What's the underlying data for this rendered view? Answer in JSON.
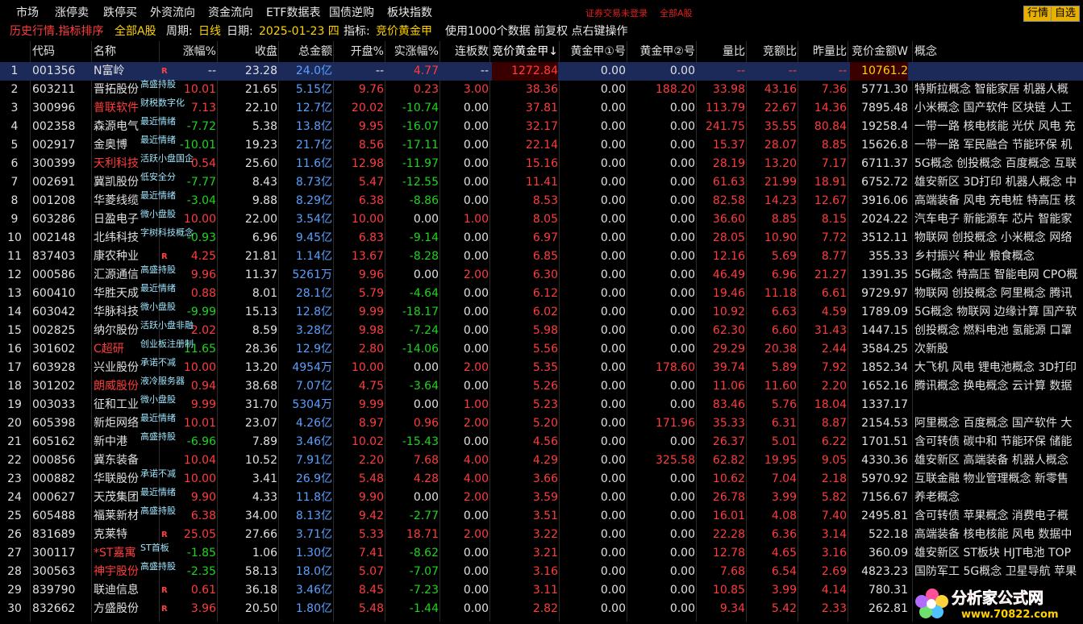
{
  "menu": [
    "市场",
    "涨停卖",
    "跌停买",
    "外资流向",
    "资金流向",
    "ETF数据表",
    "国债逆购",
    "板块指数"
  ],
  "notice_left": "证券交易未登录",
  "notice_right": "全部A股",
  "top_buttons": [
    "行情",
    "自选"
  ],
  "info": {
    "title": "历史行情.指标排序",
    "market": "全部A股",
    "period_label": "周期:",
    "period": "日线",
    "date_label": "日期:",
    "date": "2025-01-23 四",
    "indicator_label": "指标:",
    "indicator": "竞价黄金甲",
    "note": "使用1000个数据 前复权 点右键操作"
  },
  "headers": [
    "",
    "代码",
    "名称",
    "涨幅%",
    "收盘",
    "总金额",
    "开盘%",
    "实涨幅%",
    "连板数",
    "竞价黄金甲↓",
    "黄金甲①号",
    "黄金甲②号",
    "量比",
    "竞额比",
    "昨量比",
    "竞价金额W",
    "概念"
  ],
  "rows": [
    {
      "n": "1",
      "code": "001356",
      "name": "N富岭",
      "tag": "",
      "r": true,
      "nameRed": false,
      "chg": "--",
      "chgC": "num",
      "close": "23.28",
      "amt": "24.0亿",
      "open": "--",
      "openC": "num",
      "real": "4.77",
      "realC": "up",
      "lb": "--",
      "jg": "1272.84",
      "g1": "0.00",
      "g2": "0.00",
      "lb2": "--",
      "jeb": "--",
      "zlb": "--",
      "jjje": "10761.2",
      "gn": ""
    },
    {
      "n": "2",
      "code": "603211",
      "name": "晋拓股份",
      "tag": "高盛持股",
      "r": false,
      "nameRed": false,
      "chg": "10.01",
      "chgC": "up",
      "close": "21.65",
      "amt": "5.15亿",
      "open": "9.76",
      "openC": "up",
      "real": "0.23",
      "realC": "up",
      "lb": "3.00",
      "jg": "38.36",
      "g1": "0.00",
      "g2": "188.20",
      "lb2": "33.98",
      "jeb": "43.16",
      "zlb": "7.36",
      "jjje": "5771.30",
      "gn": "特斯拉概念 智能家居 机器人概"
    },
    {
      "n": "3",
      "code": "300996",
      "name": "普联软件",
      "tag": "财税数字化",
      "r": false,
      "nameRed": true,
      "chg": "7.13",
      "chgC": "up",
      "close": "22.10",
      "amt": "12.7亿",
      "open": "20.02",
      "openC": "up",
      "real": "-10.74",
      "realC": "down",
      "lb": "0.00",
      "jg": "37.81",
      "g1": "0.00",
      "g2": "0.00",
      "lb2": "113.79",
      "jeb": "22.67",
      "zlb": "14.36",
      "jjje": "7895.48",
      "gn": "小米概念 国产软件 区块链 人工"
    },
    {
      "n": "4",
      "code": "002358",
      "name": "森源电气",
      "tag": "最近情绪",
      "r": false,
      "nameRed": false,
      "chg": "-7.72",
      "chgC": "down",
      "close": "5.38",
      "amt": "13.8亿",
      "open": "9.95",
      "openC": "up",
      "real": "-16.07",
      "realC": "down",
      "lb": "0.00",
      "jg": "32.17",
      "g1": "0.00",
      "g2": "0.00",
      "lb2": "241.75",
      "jeb": "35.55",
      "zlb": "80.84",
      "jjje": "19258.4",
      "gn": "一带一路 核电核能 光伏 风电 充"
    },
    {
      "n": "5",
      "code": "002917",
      "name": "金奥博",
      "tag": "最近情绪",
      "r": false,
      "nameRed": false,
      "chg": "-10.01",
      "chgC": "down",
      "close": "19.23",
      "amt": "21.7亿",
      "open": "8.56",
      "openC": "up",
      "real": "-17.11",
      "realC": "down",
      "lb": "0.00",
      "jg": "22.14",
      "g1": "0.00",
      "g2": "0.00",
      "lb2": "15.37",
      "jeb": "28.07",
      "zlb": "8.85",
      "jjje": "15626.8",
      "gn": "一带一路 军民融合 节能环保 机"
    },
    {
      "n": "6",
      "code": "300399",
      "name": "天利科技",
      "tag": "活跃小盘国企",
      "r": false,
      "nameRed": true,
      "chg": "0.54",
      "chgC": "up",
      "close": "25.60",
      "amt": "11.6亿",
      "open": "12.98",
      "openC": "up",
      "real": "-11.97",
      "realC": "down",
      "lb": "0.00",
      "jg": "15.16",
      "g1": "0.00",
      "g2": "0.00",
      "lb2": "28.19",
      "jeb": "13.20",
      "zlb": "7.17",
      "jjje": "6711.37",
      "gn": "5G概念 创投概念 百度概念 互联"
    },
    {
      "n": "7",
      "code": "002691",
      "name": "冀凯股份",
      "tag": "低安全分",
      "r": false,
      "nameRed": false,
      "chg": "-7.77",
      "chgC": "down",
      "close": "8.43",
      "amt": "8.73亿",
      "open": "5.47",
      "openC": "up",
      "real": "-12.55",
      "realC": "down",
      "lb": "0.00",
      "jg": "11.41",
      "g1": "0.00",
      "g2": "0.00",
      "lb2": "61.63",
      "jeb": "21.99",
      "zlb": "18.91",
      "jjje": "6752.72",
      "gn": "雄安新区 3D打印 机器人概念 中"
    },
    {
      "n": "8",
      "code": "001208",
      "name": "华菱线缆",
      "tag": "最近情绪",
      "r": false,
      "nameRed": false,
      "chg": "-3.04",
      "chgC": "down",
      "close": "9.88",
      "amt": "8.29亿",
      "open": "6.38",
      "openC": "up",
      "real": "-8.86",
      "realC": "down",
      "lb": "0.00",
      "jg": "8.53",
      "g1": "0.00",
      "g2": "0.00",
      "lb2": "82.58",
      "jeb": "14.23",
      "zlb": "12.67",
      "jjje": "3916.06",
      "gn": "高端装备 风电 充电桩 特高压 核"
    },
    {
      "n": "9",
      "code": "603286",
      "name": "日盈电子",
      "tag": "微小盘股",
      "r": false,
      "nameRed": false,
      "chg": "10.00",
      "chgC": "up",
      "close": "22.00",
      "amt": "3.54亿",
      "open": "10.00",
      "openC": "up",
      "real": "0.00",
      "realC": "num",
      "lb": "1.00",
      "jg": "8.05",
      "g1": "0.00",
      "g2": "0.00",
      "lb2": "36.60",
      "jeb": "8.85",
      "zlb": "8.15",
      "jjje": "2024.22",
      "gn": "汽车电子 新能源车 芯片 智能家"
    },
    {
      "n": "10",
      "code": "002148",
      "name": "北纬科技",
      "tag": "字树科技概念",
      "r": false,
      "nameRed": false,
      "chg": "-0.93",
      "chgC": "down",
      "close": "6.96",
      "amt": "9.45亿",
      "open": "6.83",
      "openC": "up",
      "real": "-9.14",
      "realC": "down",
      "lb": "0.00",
      "jg": "6.97",
      "g1": "0.00",
      "g2": "0.00",
      "lb2": "28.05",
      "jeb": "10.90",
      "zlb": "7.72",
      "jjje": "3512.11",
      "gn": "物联网 创投概念 小米概念 网络"
    },
    {
      "n": "11",
      "code": "837403",
      "name": "康农种业",
      "tag": "",
      "r": true,
      "nameRed": false,
      "chg": "4.25",
      "chgC": "up",
      "close": "21.81",
      "amt": "1.14亿",
      "open": "13.67",
      "openC": "up",
      "real": "-8.28",
      "realC": "down",
      "lb": "0.00",
      "jg": "6.85",
      "g1": "0.00",
      "g2": "0.00",
      "lb2": "12.16",
      "jeb": "5.69",
      "zlb": "8.77",
      "jjje": "355.33",
      "gn": "乡村振兴 种业 粮食概念"
    },
    {
      "n": "12",
      "code": "000586",
      "name": "汇源通信",
      "tag": "高盛持股",
      "r": false,
      "nameRed": false,
      "chg": "9.96",
      "chgC": "up",
      "close": "11.37",
      "amt": "5261万",
      "open": "9.96",
      "openC": "up",
      "real": "0.00",
      "realC": "num",
      "lb": "2.00",
      "jg": "6.30",
      "g1": "0.00",
      "g2": "0.00",
      "lb2": "46.49",
      "jeb": "6.96",
      "zlb": "21.27",
      "jjje": "1391.35",
      "gn": "5G概念 特高压 智能电网 CPO概"
    },
    {
      "n": "13",
      "code": "600410",
      "name": "华胜天成",
      "tag": "最近情绪",
      "r": false,
      "nameRed": false,
      "chg": "0.88",
      "chgC": "up",
      "close": "8.01",
      "amt": "28.1亿",
      "open": "5.79",
      "openC": "up",
      "real": "-4.64",
      "realC": "down",
      "lb": "0.00",
      "jg": "6.12",
      "g1": "0.00",
      "g2": "0.00",
      "lb2": "19.46",
      "jeb": "11.18",
      "zlb": "6.61",
      "jjje": "9729.97",
      "gn": "物联网 创投概念 阿里概念 腾讯"
    },
    {
      "n": "14",
      "code": "603042",
      "name": "华脉科技",
      "tag": "微小盘股",
      "r": false,
      "nameRed": false,
      "chg": "-9.99",
      "chgC": "down",
      "close": "15.13",
      "amt": "12.8亿",
      "open": "9.99",
      "openC": "up",
      "real": "-18.17",
      "realC": "down",
      "lb": "0.00",
      "jg": "6.02",
      "g1": "0.00",
      "g2": "0.00",
      "lb2": "10.92",
      "jeb": "6.63",
      "zlb": "4.59",
      "jjje": "1789.09",
      "gn": "5G概念 物联网 边缘计算 国产软"
    },
    {
      "n": "15",
      "code": "002825",
      "name": "纳尔股份",
      "tag": "活跃小盘非融",
      "r": false,
      "nameRed": false,
      "chg": "2.02",
      "chgC": "up",
      "close": "8.59",
      "amt": "3.28亿",
      "open": "9.98",
      "openC": "up",
      "real": "-7.24",
      "realC": "down",
      "lb": "0.00",
      "jg": "5.98",
      "g1": "0.00",
      "g2": "0.00",
      "lb2": "62.30",
      "jeb": "6.60",
      "zlb": "31.43",
      "jjje": "1447.15",
      "gn": "创投概念 燃料电池 氢能源 口罩"
    },
    {
      "n": "16",
      "code": "301602",
      "name": "C超研",
      "tag": "创业板注册制",
      "r": false,
      "nameRed": true,
      "chg": "11.65",
      "chgC": "down",
      "close": "28.36",
      "amt": "12.9亿",
      "open": "2.80",
      "openC": "up",
      "real": "-14.06",
      "realC": "down",
      "lb": "0.00",
      "jg": "5.56",
      "g1": "0.00",
      "g2": "0.00",
      "lb2": "29.29",
      "jeb": "20.38",
      "zlb": "2.44",
      "jjje": "3584.25",
      "gn": "次新股"
    },
    {
      "n": "17",
      "code": "603928",
      "name": "兴业股份",
      "tag": "承诺不减",
      "r": false,
      "nameRed": false,
      "chg": "10.00",
      "chgC": "up",
      "close": "13.20",
      "amt": "4954万",
      "open": "10.00",
      "openC": "up",
      "real": "0.00",
      "realC": "num",
      "lb": "2.00",
      "jg": "5.35",
      "g1": "0.00",
      "g2": "178.60",
      "lb2": "39.74",
      "jeb": "5.89",
      "zlb": "7.92",
      "jjje": "1852.34",
      "gn": "大飞机 风电 锂电池概念 3D打印"
    },
    {
      "n": "18",
      "code": "301202",
      "name": "朗威股份",
      "tag": "液冷服务器",
      "r": false,
      "nameRed": true,
      "chg": "0.94",
      "chgC": "up",
      "close": "38.68",
      "amt": "7.07亿",
      "open": "4.75",
      "openC": "up",
      "real": "-3.64",
      "realC": "down",
      "lb": "0.00",
      "jg": "5.26",
      "g1": "0.00",
      "g2": "0.00",
      "lb2": "11.06",
      "jeb": "11.60",
      "zlb": "2.20",
      "jjje": "1652.16",
      "gn": "腾讯概念 换电概念 云计算 数据"
    },
    {
      "n": "19",
      "code": "003033",
      "name": "征和工业",
      "tag": "微小盘股",
      "r": false,
      "nameRed": false,
      "chg": "9.99",
      "chgC": "up",
      "close": "31.70",
      "amt": "5304万",
      "open": "9.99",
      "openC": "up",
      "real": "0.00",
      "realC": "num",
      "lb": "1.00",
      "jg": "5.23",
      "g1": "0.00",
      "g2": "0.00",
      "lb2": "83.46",
      "jeb": "5.76",
      "zlb": "18.04",
      "jjje": "1337.17",
      "gn": ""
    },
    {
      "n": "20",
      "code": "605398",
      "name": "新炬网络",
      "tag": "最近情绪",
      "r": false,
      "nameRed": false,
      "chg": "10.01",
      "chgC": "up",
      "close": "23.07",
      "amt": "4.26亿",
      "open": "8.97",
      "openC": "up",
      "real": "0.96",
      "realC": "up",
      "lb": "2.00",
      "jg": "5.20",
      "g1": "0.00",
      "g2": "171.96",
      "lb2": "35.33",
      "jeb": "6.31",
      "zlb": "8.87",
      "jjje": "2154.53",
      "gn": "阿里概念 百度概念 国产软件 大"
    },
    {
      "n": "21",
      "code": "605162",
      "name": "新中港",
      "tag": "高盛持股",
      "r": false,
      "nameRed": false,
      "chg": "-6.96",
      "chgC": "down",
      "close": "7.89",
      "amt": "3.46亿",
      "open": "10.02",
      "openC": "up",
      "real": "-15.43",
      "realC": "down",
      "lb": "0.00",
      "jg": "4.56",
      "g1": "0.00",
      "g2": "0.00",
      "lb2": "26.37",
      "jeb": "5.01",
      "zlb": "6.22",
      "jjje": "1701.51",
      "gn": "含可转债 碳中和 节能环保 储能"
    },
    {
      "n": "22",
      "code": "000856",
      "name": "冀东装备",
      "tag": "",
      "r": false,
      "nameRed": false,
      "chg": "10.04",
      "chgC": "up",
      "close": "10.52",
      "amt": "7.91亿",
      "open": "2.20",
      "openC": "up",
      "real": "7.68",
      "realC": "up",
      "lb": "4.00",
      "jg": "4.29",
      "g1": "0.00",
      "g2": "325.58",
      "lb2": "62.82",
      "jeb": "19.95",
      "zlb": "9.05",
      "jjje": "4330.36",
      "gn": "雄安新区 高端装备 机器人概念"
    },
    {
      "n": "23",
      "code": "000882",
      "name": "华联股份",
      "tag": "承诺不减",
      "r": false,
      "nameRed": false,
      "chg": "10.00",
      "chgC": "up",
      "close": "3.41",
      "amt": "26.9亿",
      "open": "5.48",
      "openC": "up",
      "real": "4.28",
      "realC": "up",
      "lb": "4.00",
      "jg": "3.66",
      "g1": "0.00",
      "g2": "0.00",
      "lb2": "10.62",
      "jeb": "7.04",
      "zlb": "2.18",
      "jjje": "5970.92",
      "gn": "互联金融 物业管理概念 新零售"
    },
    {
      "n": "24",
      "code": "000627",
      "name": "天茂集团",
      "tag": "最近情绪",
      "r": false,
      "nameRed": false,
      "chg": "9.90",
      "chgC": "up",
      "close": "4.33",
      "amt": "11.8亿",
      "open": "9.90",
      "openC": "up",
      "real": "0.00",
      "realC": "num",
      "lb": "2.00",
      "jg": "3.59",
      "g1": "0.00",
      "g2": "0.00",
      "lb2": "26.78",
      "jeb": "3.99",
      "zlb": "5.82",
      "jjje": "7156.67",
      "gn": "养老概念"
    },
    {
      "n": "25",
      "code": "605488",
      "name": "福莱新材",
      "tag": "高盛持股",
      "r": false,
      "nameRed": false,
      "chg": "6.38",
      "chgC": "up",
      "close": "34.00",
      "amt": "8.13亿",
      "open": "9.42",
      "openC": "up",
      "real": "-2.77",
      "realC": "down",
      "lb": "0.00",
      "jg": "3.51",
      "g1": "0.00",
      "g2": "0.00",
      "lb2": "16.01",
      "jeb": "4.08",
      "zlb": "7.40",
      "jjje": "2495.81",
      "gn": "含可转债 苹果概念 消费电子概"
    },
    {
      "n": "26",
      "code": "831689",
      "name": "克莱特",
      "tag": "",
      "r": true,
      "nameRed": false,
      "chg": "25.05",
      "chgC": "up",
      "close": "27.66",
      "amt": "3.71亿",
      "open": "5.33",
      "openC": "up",
      "real": "18.71",
      "realC": "up",
      "lb": "2.00",
      "jg": "3.22",
      "g1": "0.00",
      "g2": "0.00",
      "lb2": "22.28",
      "jeb": "6.36",
      "zlb": "3.14",
      "jjje": "522.18",
      "gn": "高端装备 核电核能 风电 数据中"
    },
    {
      "n": "27",
      "code": "300117",
      "name": "*ST嘉寓",
      "tag": "ST首板",
      "r": false,
      "nameRed": true,
      "chg": "-1.85",
      "chgC": "down",
      "close": "1.06",
      "amt": "1.30亿",
      "open": "7.41",
      "openC": "up",
      "real": "-8.62",
      "realC": "down",
      "lb": "0.00",
      "jg": "3.21",
      "g1": "0.00",
      "g2": "0.00",
      "lb2": "12.78",
      "jeb": "4.65",
      "zlb": "3.16",
      "jjje": "360.09",
      "gn": "雄安新区 ST板块 HJT电池 TOP"
    },
    {
      "n": "28",
      "code": "300563",
      "name": "神宇股份",
      "tag": "高盛持股",
      "r": false,
      "nameRed": true,
      "chg": "-2.35",
      "chgC": "down",
      "close": "58.13",
      "amt": "18.0亿",
      "open": "5.07",
      "openC": "up",
      "real": "-7.07",
      "realC": "down",
      "lb": "0.00",
      "jg": "3.16",
      "g1": "0.00",
      "g2": "0.00",
      "lb2": "7.68",
      "jeb": "6.54",
      "zlb": "2.69",
      "jjje": "4823.23",
      "gn": "国防军工 5G概念 卫星导航 苹果"
    },
    {
      "n": "29",
      "code": "839790",
      "name": "联迪信息",
      "tag": "",
      "r": true,
      "nameRed": false,
      "chg": "0.61",
      "chgC": "up",
      "close": "36.18",
      "amt": "3.46亿",
      "open": "8.45",
      "openC": "up",
      "real": "-7.23",
      "realC": "down",
      "lb": "0.00",
      "jg": "3.11",
      "g1": "0.00",
      "g2": "0.00",
      "lb2": "10.85",
      "jeb": "3.99",
      "zlb": "4.14",
      "jjje": "780.31",
      "gn": ""
    },
    {
      "n": "30",
      "code": "832662",
      "name": "方盛股份",
      "tag": "",
      "r": true,
      "nameRed": false,
      "chg": "3.96",
      "chgC": "up",
      "close": "20.50",
      "amt": "1.80亿",
      "open": "5.48",
      "openC": "up",
      "real": "-1.44",
      "realC": "down",
      "lb": "0.00",
      "jg": "2.82",
      "g1": "0.00",
      "g2": "0.00",
      "lb2": "9.34",
      "jeb": "5.42",
      "zlb": "2.33",
      "jjje": "262.81",
      "gn": ""
    }
  ],
  "logo": {
    "text": "分析家公式网",
    "url": "www.70822.com"
  },
  "colors": {
    "up": "#ff3c3c",
    "down": "#1fd41f",
    "amount": "#5aa0ff",
    "accent": "#ffd200",
    "selected_row": "#1c2a5a"
  }
}
